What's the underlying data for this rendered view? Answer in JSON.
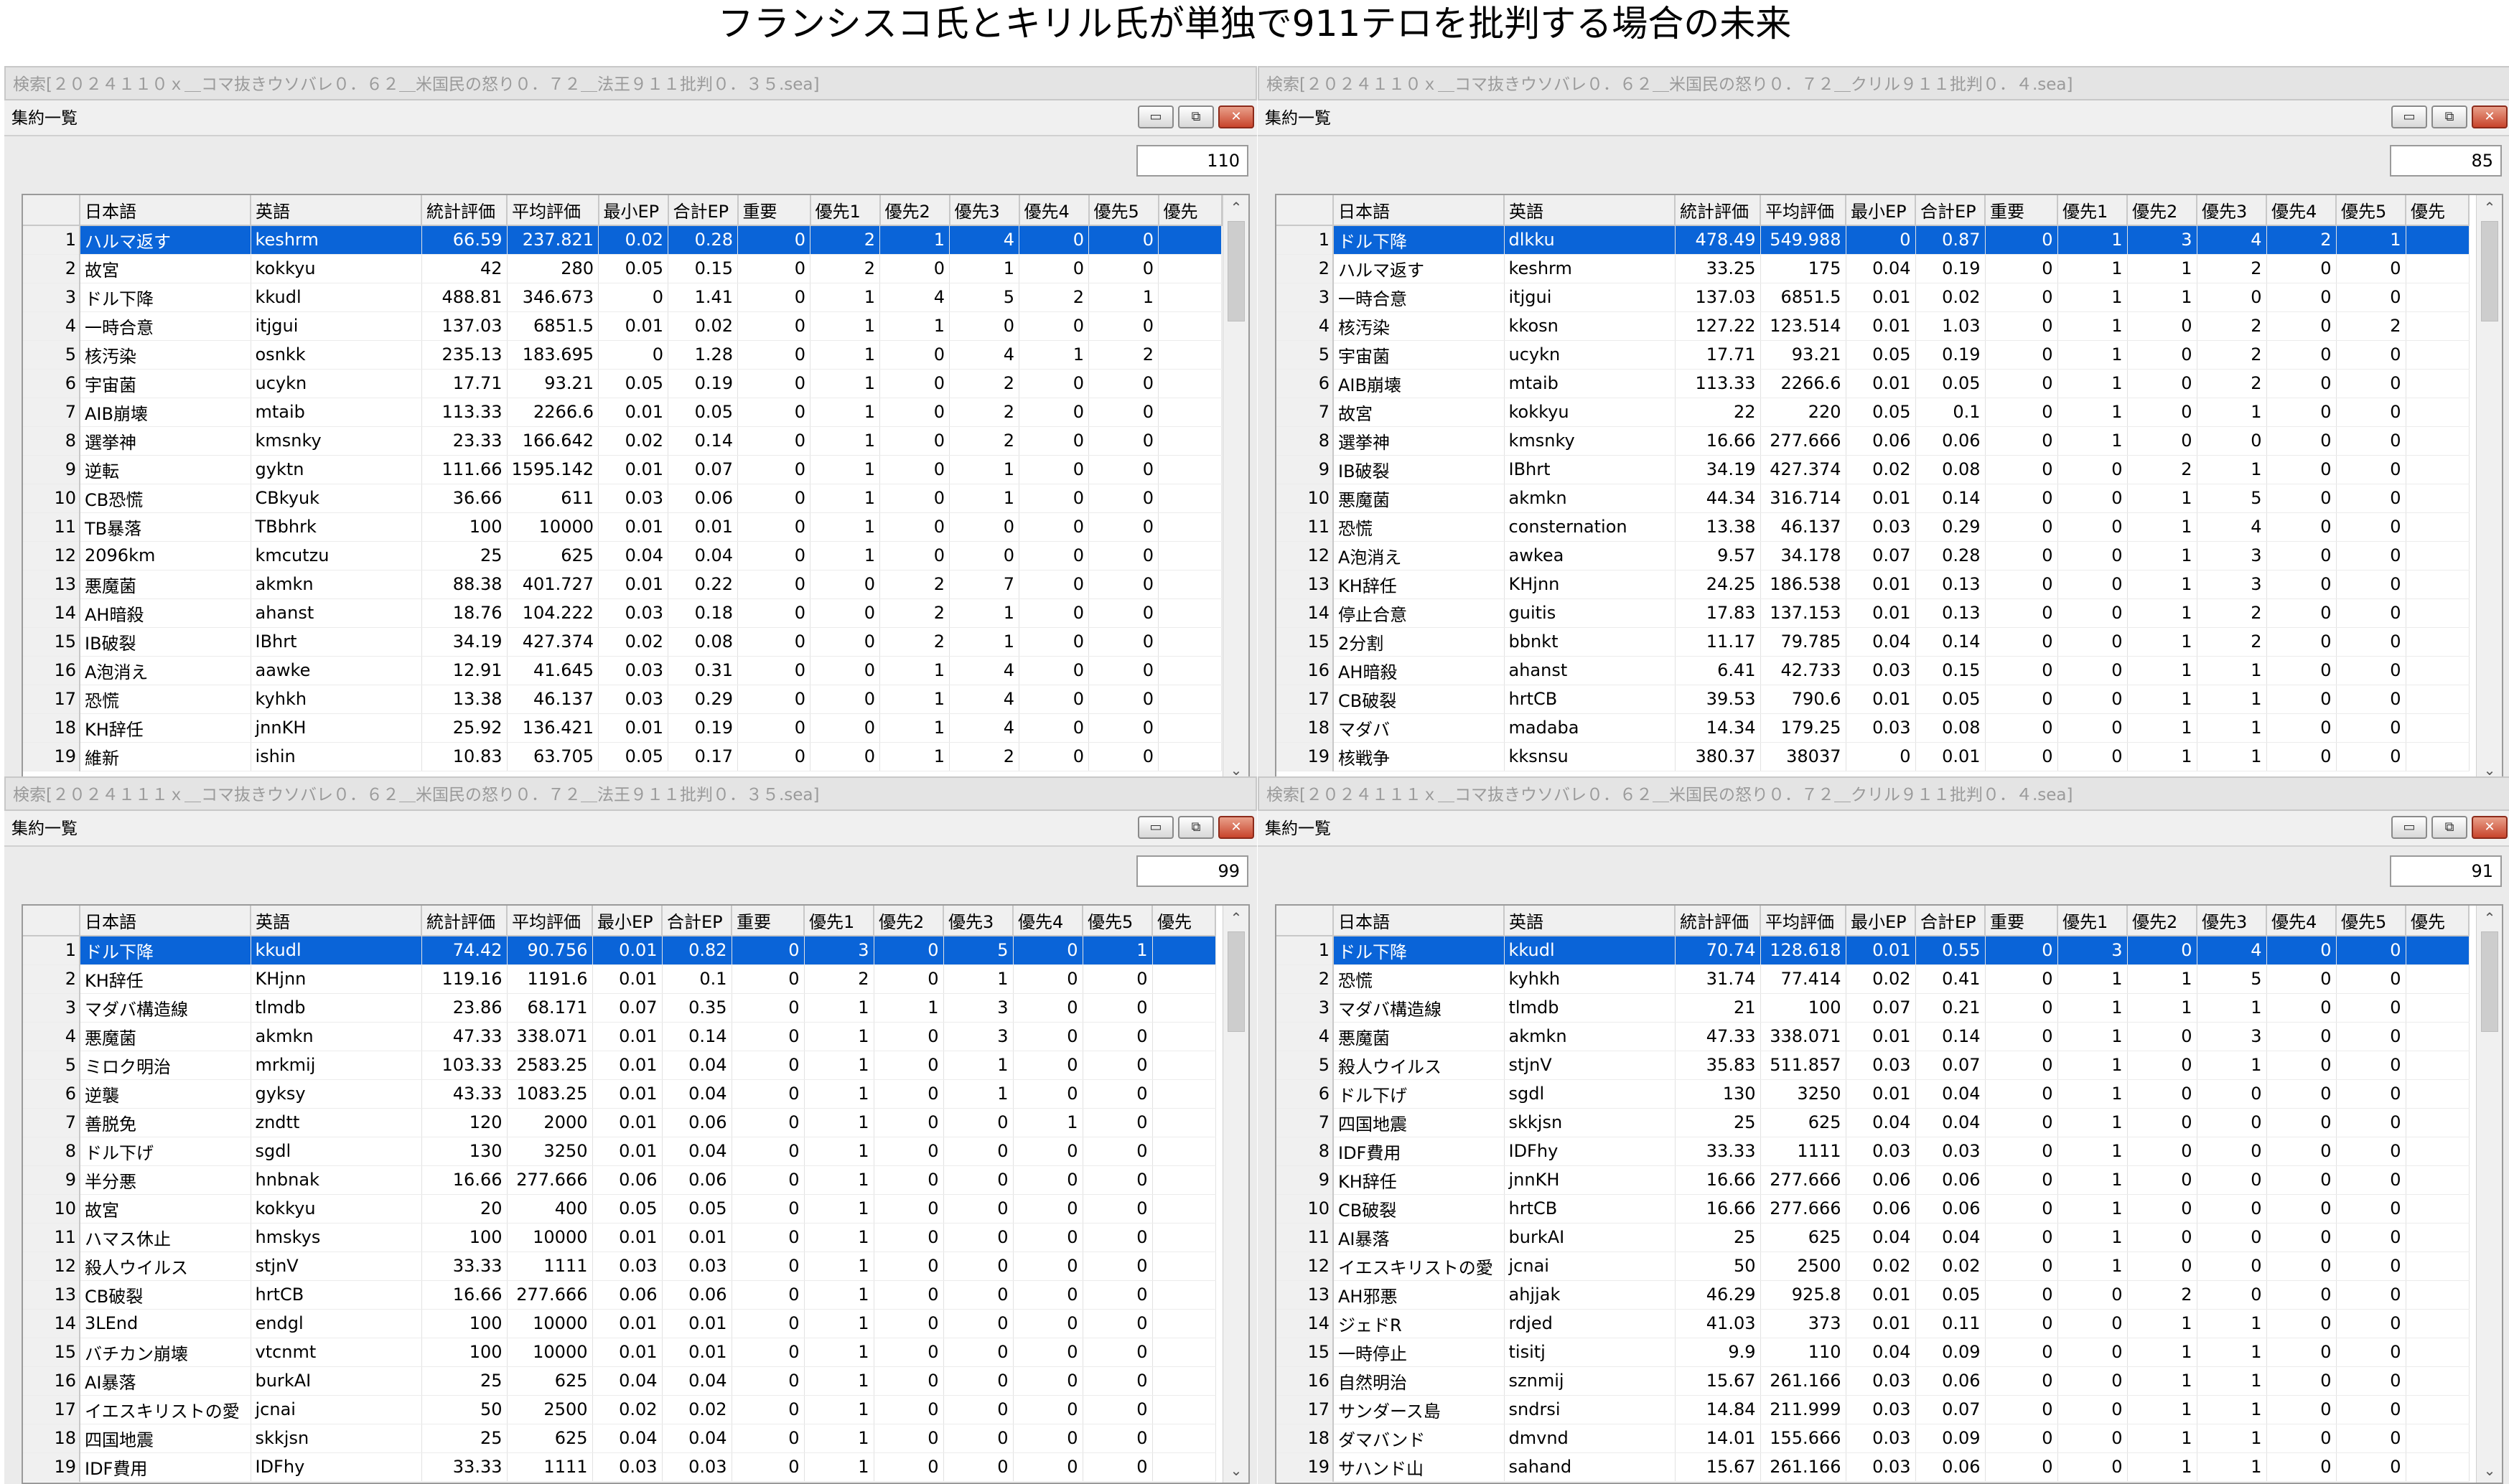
{
  "page_title": "フランシスコ氏とキリル氏が単独で911テロを批判する場合の未来",
  "columns": [
    "日本語",
    "英語",
    "統計評価",
    "平均評価",
    "最小EP",
    "合計EP",
    "重要",
    "優先1",
    "優先2",
    "優先3",
    "優先4",
    "優先5",
    "優先"
  ],
  "inner_title": "集約一覧",
  "buttons": {
    "minimize": "▭",
    "restore": "⧉",
    "close": "✕"
  },
  "scroll": {
    "up": "⌃",
    "down": "⌄"
  },
  "panes": [
    {
      "outer_title": "検索[２０２４１１０ｘ＿コマ抜きウソバレ０．６２＿米国民の怒り０．７２＿法王９１１批判０．３５.sea]",
      "count": "110",
      "selected": 0,
      "rows": [
        [
          "1",
          "ハルマ返す",
          "keshrm",
          "66.59",
          "237.821",
          "0.02",
          "0.28",
          "0",
          "2",
          "1",
          "4",
          "0",
          "0"
        ],
        [
          "2",
          "故宮",
          "kokkyu",
          "42",
          "280",
          "0.05",
          "0.15",
          "0",
          "2",
          "0",
          "1",
          "0",
          "0"
        ],
        [
          "3",
          "ドル下降",
          "kkudl",
          "488.81",
          "346.673",
          "0",
          "1.41",
          "0",
          "1",
          "4",
          "5",
          "2",
          "1"
        ],
        [
          "4",
          "一時合意",
          "itjgui",
          "137.03",
          "6851.5",
          "0.01",
          "0.02",
          "0",
          "1",
          "1",
          "0",
          "0",
          "0"
        ],
        [
          "5",
          "核汚染",
          "osnkk",
          "235.13",
          "183.695",
          "0",
          "1.28",
          "0",
          "1",
          "0",
          "4",
          "1",
          "2"
        ],
        [
          "6",
          "宇宙菌",
          "ucykn",
          "17.71",
          "93.21",
          "0.05",
          "0.19",
          "0",
          "1",
          "0",
          "2",
          "0",
          "0"
        ],
        [
          "7",
          "AIB崩壊",
          "mtaib",
          "113.33",
          "2266.6",
          "0.01",
          "0.05",
          "0",
          "1",
          "0",
          "2",
          "0",
          "0"
        ],
        [
          "8",
          "選挙神",
          "kmsnky",
          "23.33",
          "166.642",
          "0.02",
          "0.14",
          "0",
          "1",
          "0",
          "2",
          "0",
          "0"
        ],
        [
          "9",
          "逆転",
          "gyktn",
          "111.66",
          "1595.142",
          "0.01",
          "0.07",
          "0",
          "1",
          "0",
          "1",
          "0",
          "0"
        ],
        [
          "10",
          "CB恐慌",
          "CBkyuk",
          "36.66",
          "611",
          "0.03",
          "0.06",
          "0",
          "1",
          "0",
          "1",
          "0",
          "0"
        ],
        [
          "11",
          "TB暴落",
          "TBbhrk",
          "100",
          "10000",
          "0.01",
          "0.01",
          "0",
          "1",
          "0",
          "0",
          "0",
          "0"
        ],
        [
          "12",
          "2096km",
          "kmcutzu",
          "25",
          "625",
          "0.04",
          "0.04",
          "0",
          "1",
          "0",
          "0",
          "0",
          "0"
        ],
        [
          "13",
          "悪魔菌",
          "akmkn",
          "88.38",
          "401.727",
          "0.01",
          "0.22",
          "0",
          "0",
          "2",
          "7",
          "0",
          "0"
        ],
        [
          "14",
          "AH暗殺",
          "ahanst",
          "18.76",
          "104.222",
          "0.03",
          "0.18",
          "0",
          "0",
          "2",
          "1",
          "0",
          "0"
        ],
        [
          "15",
          "IB破裂",
          "IBhrt",
          "34.19",
          "427.374",
          "0.02",
          "0.08",
          "0",
          "0",
          "2",
          "1",
          "0",
          "0"
        ],
        [
          "16",
          "A泡消え",
          "aawke",
          "12.91",
          "41.645",
          "0.03",
          "0.31",
          "0",
          "0",
          "1",
          "4",
          "0",
          "0"
        ],
        [
          "17",
          "恐慌",
          "kyhkh",
          "13.38",
          "46.137",
          "0.03",
          "0.29",
          "0",
          "0",
          "1",
          "4",
          "0",
          "0"
        ],
        [
          "18",
          "KH辞任",
          "jnnKH",
          "25.92",
          "136.421",
          "0.01",
          "0.19",
          "0",
          "0",
          "1",
          "4",
          "0",
          "0"
        ],
        [
          "19",
          "維新",
          "ishin",
          "10.83",
          "63.705",
          "0.05",
          "0.17",
          "0",
          "0",
          "1",
          "2",
          "0",
          "0"
        ]
      ]
    },
    {
      "outer_title": "検索[２０２４１１０ｘ＿コマ抜きウソバレ０．６２＿米国民の怒り０．７２＿クリル９１１批判０．４.sea]",
      "count": "85",
      "selected": 0,
      "rows": [
        [
          "1",
          "ドル下降",
          "dlkku",
          "478.49",
          "549.988",
          "0",
          "0.87",
          "0",
          "1",
          "3",
          "4",
          "2",
          "1"
        ],
        [
          "2",
          "ハルマ返す",
          "keshrm",
          "33.25",
          "175",
          "0.04",
          "0.19",
          "0",
          "1",
          "1",
          "2",
          "0",
          "0"
        ],
        [
          "3",
          "一時合意",
          "itjgui",
          "137.03",
          "6851.5",
          "0.01",
          "0.02",
          "0",
          "1",
          "1",
          "0",
          "0",
          "0"
        ],
        [
          "4",
          "核汚染",
          "kkosn",
          "127.22",
          "123.514",
          "0.01",
          "1.03",
          "0",
          "1",
          "0",
          "2",
          "0",
          "2"
        ],
        [
          "5",
          "宇宙菌",
          "ucykn",
          "17.71",
          "93.21",
          "0.05",
          "0.19",
          "0",
          "1",
          "0",
          "2",
          "0",
          "0"
        ],
        [
          "6",
          "AIB崩壊",
          "mtaib",
          "113.33",
          "2266.6",
          "0.01",
          "0.05",
          "0",
          "1",
          "0",
          "2",
          "0",
          "0"
        ],
        [
          "7",
          "故宮",
          "kokkyu",
          "22",
          "220",
          "0.05",
          "0.1",
          "0",
          "1",
          "0",
          "1",
          "0",
          "0"
        ],
        [
          "8",
          "選挙神",
          "kmsnky",
          "16.66",
          "277.666",
          "0.06",
          "0.06",
          "0",
          "1",
          "0",
          "0",
          "0",
          "0"
        ],
        [
          "9",
          "IB破裂",
          "IBhrt",
          "34.19",
          "427.374",
          "0.02",
          "0.08",
          "0",
          "0",
          "2",
          "1",
          "0",
          "0"
        ],
        [
          "10",
          "悪魔菌",
          "akmkn",
          "44.34",
          "316.714",
          "0.01",
          "0.14",
          "0",
          "0",
          "1",
          "5",
          "0",
          "0"
        ],
        [
          "11",
          "恐慌",
          "consternation",
          "13.38",
          "46.137",
          "0.03",
          "0.29",
          "0",
          "0",
          "1",
          "4",
          "0",
          "0"
        ],
        [
          "12",
          "A泡消え",
          "awkea",
          "9.57",
          "34.178",
          "0.07",
          "0.28",
          "0",
          "0",
          "1",
          "3",
          "0",
          "0"
        ],
        [
          "13",
          "KH辞任",
          "KHjnn",
          "24.25",
          "186.538",
          "0.01",
          "0.13",
          "0",
          "0",
          "1",
          "3",
          "0",
          "0"
        ],
        [
          "14",
          "停止合意",
          "guitis",
          "17.83",
          "137.153",
          "0.01",
          "0.13",
          "0",
          "0",
          "1",
          "2",
          "0",
          "0"
        ],
        [
          "15",
          "2分割",
          "bbnkt",
          "11.17",
          "79.785",
          "0.04",
          "0.14",
          "0",
          "0",
          "1",
          "2",
          "0",
          "0"
        ],
        [
          "16",
          "AH暗殺",
          "ahanst",
          "6.41",
          "42.733",
          "0.03",
          "0.15",
          "0",
          "0",
          "1",
          "1",
          "0",
          "0"
        ],
        [
          "17",
          "CB破裂",
          "hrtCB",
          "39.53",
          "790.6",
          "0.01",
          "0.05",
          "0",
          "0",
          "1",
          "1",
          "0",
          "0"
        ],
        [
          "18",
          "マダバ",
          "madaba",
          "14.34",
          "179.25",
          "0.03",
          "0.08",
          "0",
          "0",
          "1",
          "1",
          "0",
          "0"
        ],
        [
          "19",
          "核戦争",
          "kksnsu",
          "380.37",
          "38037",
          "0",
          "0.01",
          "0",
          "0",
          "1",
          "1",
          "0",
          "0"
        ]
      ]
    },
    {
      "outer_title": "検索[２０２４１１１ｘ＿コマ抜きウソバレ０．６２＿米国民の怒り０．７２＿法王９１１批判０．３５.sea]",
      "count": "99",
      "selected": 0,
      "rows": [
        [
          "1",
          "ドル下降",
          "kkudl",
          "74.42",
          "90.756",
          "0.01",
          "0.82",
          "0",
          "3",
          "0",
          "5",
          "0",
          "1"
        ],
        [
          "2",
          "KH辞任",
          "KHjnn",
          "119.16",
          "1191.6",
          "0.01",
          "0.1",
          "0",
          "2",
          "0",
          "1",
          "0",
          "0"
        ],
        [
          "3",
          "マダバ構造線",
          "tlmdb",
          "23.86",
          "68.171",
          "0.07",
          "0.35",
          "0",
          "1",
          "1",
          "3",
          "0",
          "0"
        ],
        [
          "4",
          "悪魔菌",
          "akmkn",
          "47.33",
          "338.071",
          "0.01",
          "0.14",
          "0",
          "1",
          "0",
          "3",
          "0",
          "0"
        ],
        [
          "5",
          "ミロク明治",
          "mrkmij",
          "103.33",
          "2583.25",
          "0.01",
          "0.04",
          "0",
          "1",
          "0",
          "1",
          "0",
          "0"
        ],
        [
          "6",
          "逆襲",
          "gyksy",
          "43.33",
          "1083.25",
          "0.01",
          "0.04",
          "0",
          "1",
          "0",
          "1",
          "0",
          "0"
        ],
        [
          "7",
          "善脱免",
          "zndtt",
          "120",
          "2000",
          "0.01",
          "0.06",
          "0",
          "1",
          "0",
          "0",
          "1",
          "0"
        ],
        [
          "8",
          "ドル下げ",
          "sgdl",
          "130",
          "3250",
          "0.01",
          "0.04",
          "0",
          "1",
          "0",
          "0",
          "0",
          "0"
        ],
        [
          "9",
          "半分悪",
          "hnbnak",
          "16.66",
          "277.666",
          "0.06",
          "0.06",
          "0",
          "1",
          "0",
          "0",
          "0",
          "0"
        ],
        [
          "10",
          "故宮",
          "kokkyu",
          "20",
          "400",
          "0.05",
          "0.05",
          "0",
          "1",
          "0",
          "0",
          "0",
          "0"
        ],
        [
          "11",
          "ハマス休止",
          "hmskys",
          "100",
          "10000",
          "0.01",
          "0.01",
          "0",
          "1",
          "0",
          "0",
          "0",
          "0"
        ],
        [
          "12",
          "殺人ウイルス",
          "stjnV",
          "33.33",
          "1111",
          "0.03",
          "0.03",
          "0",
          "1",
          "0",
          "0",
          "0",
          "0"
        ],
        [
          "13",
          "CB破裂",
          "hrtCB",
          "16.66",
          "277.666",
          "0.06",
          "0.06",
          "0",
          "1",
          "0",
          "0",
          "0",
          "0"
        ],
        [
          "14",
          "3LEnd",
          "endgl",
          "100",
          "10000",
          "0.01",
          "0.01",
          "0",
          "1",
          "0",
          "0",
          "0",
          "0"
        ],
        [
          "15",
          "バチカン崩壊",
          "vtcnmt",
          "100",
          "10000",
          "0.01",
          "0.01",
          "0",
          "1",
          "0",
          "0",
          "0",
          "0"
        ],
        [
          "16",
          "AI暴落",
          "burkAI",
          "25",
          "625",
          "0.04",
          "0.04",
          "0",
          "1",
          "0",
          "0",
          "0",
          "0"
        ],
        [
          "17",
          "イエスキリストの愛",
          "jcnai",
          "50",
          "2500",
          "0.02",
          "0.02",
          "0",
          "1",
          "0",
          "0",
          "0",
          "0"
        ],
        [
          "18",
          "四国地震",
          "skkjsn",
          "25",
          "625",
          "0.04",
          "0.04",
          "0",
          "1",
          "0",
          "0",
          "0",
          "0"
        ],
        [
          "19",
          "IDF費用",
          "IDFhy",
          "33.33",
          "1111",
          "0.03",
          "0.03",
          "0",
          "1",
          "0",
          "0",
          "0",
          "0"
        ]
      ]
    },
    {
      "outer_title": "検索[２０２４１１１ｘ＿コマ抜きウソバレ０．６２＿米国民の怒り０．７２＿クリル９１１批判０．４.sea]",
      "count": "91",
      "selected": 0,
      "rows": [
        [
          "1",
          "ドル下降",
          "kkudl",
          "70.74",
          "128.618",
          "0.01",
          "0.55",
          "0",
          "3",
          "0",
          "4",
          "0",
          "0"
        ],
        [
          "2",
          "恐慌",
          "kyhkh",
          "31.74",
          "77.414",
          "0.02",
          "0.41",
          "0",
          "1",
          "1",
          "5",
          "0",
          "0"
        ],
        [
          "3",
          "マダバ構造線",
          "tlmdb",
          "21",
          "100",
          "0.07",
          "0.21",
          "0",
          "1",
          "1",
          "1",
          "0",
          "0"
        ],
        [
          "4",
          "悪魔菌",
          "akmkn",
          "47.33",
          "338.071",
          "0.01",
          "0.14",
          "0",
          "1",
          "0",
          "3",
          "0",
          "0"
        ],
        [
          "5",
          "殺人ウイルス",
          "stjnV",
          "35.83",
          "511.857",
          "0.03",
          "0.07",
          "0",
          "1",
          "0",
          "1",
          "0",
          "0"
        ],
        [
          "6",
          "ドル下げ",
          "sgdl",
          "130",
          "3250",
          "0.01",
          "0.04",
          "0",
          "1",
          "0",
          "0",
          "0",
          "0"
        ],
        [
          "7",
          "四国地震",
          "skkjsn",
          "25",
          "625",
          "0.04",
          "0.04",
          "0",
          "1",
          "0",
          "0",
          "0",
          "0"
        ],
        [
          "8",
          "IDF費用",
          "IDFhy",
          "33.33",
          "1111",
          "0.03",
          "0.03",
          "0",
          "1",
          "0",
          "0",
          "0",
          "0"
        ],
        [
          "9",
          "KH辞任",
          "jnnKH",
          "16.66",
          "277.666",
          "0.06",
          "0.06",
          "0",
          "1",
          "0",
          "0",
          "0",
          "0"
        ],
        [
          "10",
          "CB破裂",
          "hrtCB",
          "16.66",
          "277.666",
          "0.06",
          "0.06",
          "0",
          "1",
          "0",
          "0",
          "0",
          "0"
        ],
        [
          "11",
          "AI暴落",
          "burkAI",
          "25",
          "625",
          "0.04",
          "0.04",
          "0",
          "1",
          "0",
          "0",
          "0",
          "0"
        ],
        [
          "12",
          "イエスキリストの愛",
          "jcnai",
          "50",
          "2500",
          "0.02",
          "0.02",
          "0",
          "1",
          "0",
          "0",
          "0",
          "0"
        ],
        [
          "13",
          "AH邪悪",
          "ahjjak",
          "46.29",
          "925.8",
          "0.01",
          "0.05",
          "0",
          "0",
          "2",
          "0",
          "0",
          "0"
        ],
        [
          "14",
          "ジェドR",
          "rdjed",
          "41.03",
          "373",
          "0.01",
          "0.11",
          "0",
          "0",
          "1",
          "1",
          "0",
          "0"
        ],
        [
          "15",
          "一時停止",
          "tisitj",
          "9.9",
          "110",
          "0.04",
          "0.09",
          "0",
          "0",
          "1",
          "1",
          "0",
          "0"
        ],
        [
          "16",
          "自然明治",
          "sznmij",
          "15.67",
          "261.166",
          "0.03",
          "0.06",
          "0",
          "0",
          "1",
          "1",
          "0",
          "0"
        ],
        [
          "17",
          "サンダース島",
          "sndrsi",
          "14.84",
          "211.999",
          "0.03",
          "0.07",
          "0",
          "0",
          "1",
          "1",
          "0",
          "0"
        ],
        [
          "18",
          "ダマバンド",
          "dmvnd",
          "14.01",
          "155.666",
          "0.03",
          "0.09",
          "0",
          "0",
          "1",
          "1",
          "0",
          "0"
        ],
        [
          "19",
          "サハンド山",
          "sahand",
          "15.67",
          "261.166",
          "0.03",
          "0.06",
          "0",
          "0",
          "1",
          "1",
          "0",
          "0"
        ]
      ]
    }
  ]
}
